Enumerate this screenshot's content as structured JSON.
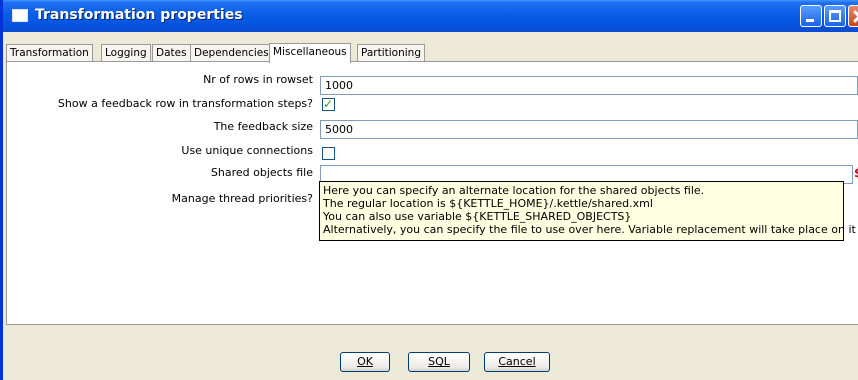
{
  "window": {
    "title": "Transformation properties"
  },
  "tabs": [
    {
      "label": "Transformation",
      "active": false
    },
    {
      "label": "Logging",
      "active": false
    },
    {
      "label": "Dates",
      "active": false
    },
    {
      "label": "Dependencies",
      "active": false
    },
    {
      "label": "Miscellaneous",
      "active": true
    },
    {
      "label": "Partitioning",
      "active": false
    }
  ],
  "form": {
    "rows_in_rowset": {
      "label": "Nr of rows in rowset",
      "value": "1000"
    },
    "feedback_row": {
      "label": "Show a feedback row in transformation steps?",
      "checked": true
    },
    "feedback_size": {
      "label": "The feedback size",
      "value": "5000"
    },
    "unique_connections": {
      "label": "Use unique connections",
      "checked": false
    },
    "shared_objects_file": {
      "label": "Shared objects file",
      "value": "",
      "variable_icon": "$"
    },
    "manage_thread_priorities": {
      "label": "Manage thread priorities?",
      "checked": true
    }
  },
  "tooltip": {
    "lines": [
      "Here you can specify an alternate location for the shared objects file.",
      "The regular location is ${KETTLE_HOME}/.kettle/shared.xml",
      "You can also use variable ${KETTLE_SHARED_OBJECTS}",
      "Alternatively, you can specify the file to use over here. Variable replacement will take place on it too."
    ]
  },
  "buttons": {
    "ok": "OK",
    "sql": "SQL",
    "cancel": "Cancel"
  },
  "colors": {
    "titlebar": "#0553e0",
    "tooltip_bg": "#ffffe1",
    "check": "#21a121"
  }
}
